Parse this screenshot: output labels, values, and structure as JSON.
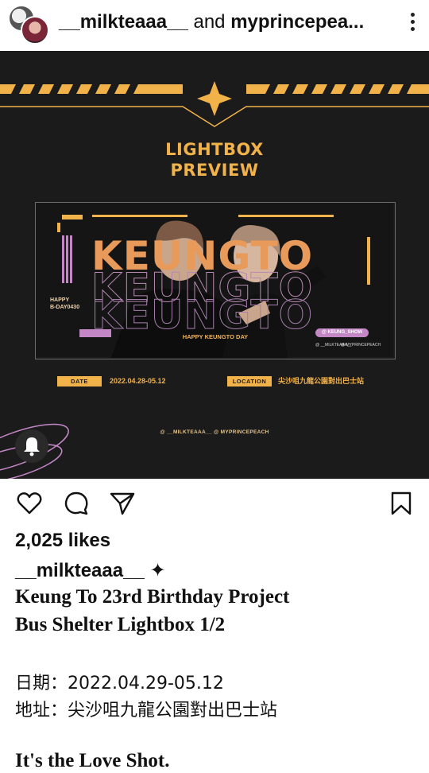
{
  "header": {
    "user1": "__milkteaaa__",
    "joiner": "and",
    "user2": "myprincepea..."
  },
  "poster": {
    "title_line1": "LIGHTBOX",
    "title_line2": "PREVIEW",
    "banner_name": "KEUNGTO",
    "happy_bday": "HAPPY\nB-DAY0430",
    "happy_day": "HAPPY KEUNGTO DAY",
    "handle_pill": "@ KEUNG_SHOW",
    "small_handle_left": "@ __MILKTEAAA__",
    "small_handle_right": "@ MYPRINCEPEACH",
    "date_label": "DATE",
    "date_value": "2022.04.28-05.12",
    "location_label": "LOCATION",
    "location_value": "尖沙咀九龍公園對出巴士站",
    "footer_handles": "@ __MILKTEAAA__   @ MYPRINCEPEACH"
  },
  "post": {
    "likes": "2,025 likes",
    "username": "__milkteaaa__ ✦",
    "caption_line1": "Keung To 23rd Birthday Project",
    "caption_line2": "Bus Shelter Lightbox 1/2",
    "date_line": "日期：2022.04.29-05.12",
    "address_line": "地址：尖沙咀九龍公園對出巴士站",
    "closing_line": "It's the Love Shot."
  },
  "icons": [
    "more-icon",
    "heart-icon",
    "comment-icon",
    "share-icon",
    "bookmark-icon",
    "bell-icon"
  ],
  "colors": {
    "accent_gold": "#f2b24a",
    "poster_bg": "#1b1b1c",
    "pink": "#c487c6"
  }
}
